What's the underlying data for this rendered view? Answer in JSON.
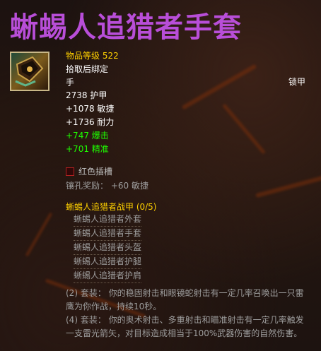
{
  "item": {
    "name": "蜥蜴人追猎者手套",
    "level_label": "物品等级",
    "level_value": "522",
    "bind": "拾取后绑定",
    "slot": "手",
    "armor_type": "锁甲",
    "armor": "2738 护甲",
    "stats": [
      "+1078 敏捷",
      "+1736 耐力"
    ],
    "secondary_stats": [
      "+747 爆击",
      "+701 精准"
    ],
    "socket": "红色插槽",
    "socket_bonus": "镶孔奖励： +60 敏捷"
  },
  "set": {
    "title": "蜥蜴人追猎者战甲 (0/5)",
    "items": [
      "蜥蜴人追猎者外套",
      "蜥蜴人追猎者手套",
      "蜥蜴人追猎者头盔",
      "蜥蜴人追猎者护腿",
      "蜥蜴人追猎者护肩"
    ],
    "bonuses": [
      "(2) 套装： 你的稳固射击和眼镜蛇射击有一定几率召唤出一只雷鹰为你作战，持续10秒。",
      "(4) 套装： 你的奥术射击、多重射击和瞄准射击有一定几率触发一支雷光箭矢，对目标造成相当于100%武器伤害的自然伤害。"
    ]
  },
  "colors": {
    "title": "#b84ed8",
    "yellow": "#ffd100",
    "green": "#1eff00",
    "grey": "#9d9d9d"
  },
  "icons": {
    "item_icon": "gloves-icon",
    "socket_icon": "red-socket-icon"
  }
}
